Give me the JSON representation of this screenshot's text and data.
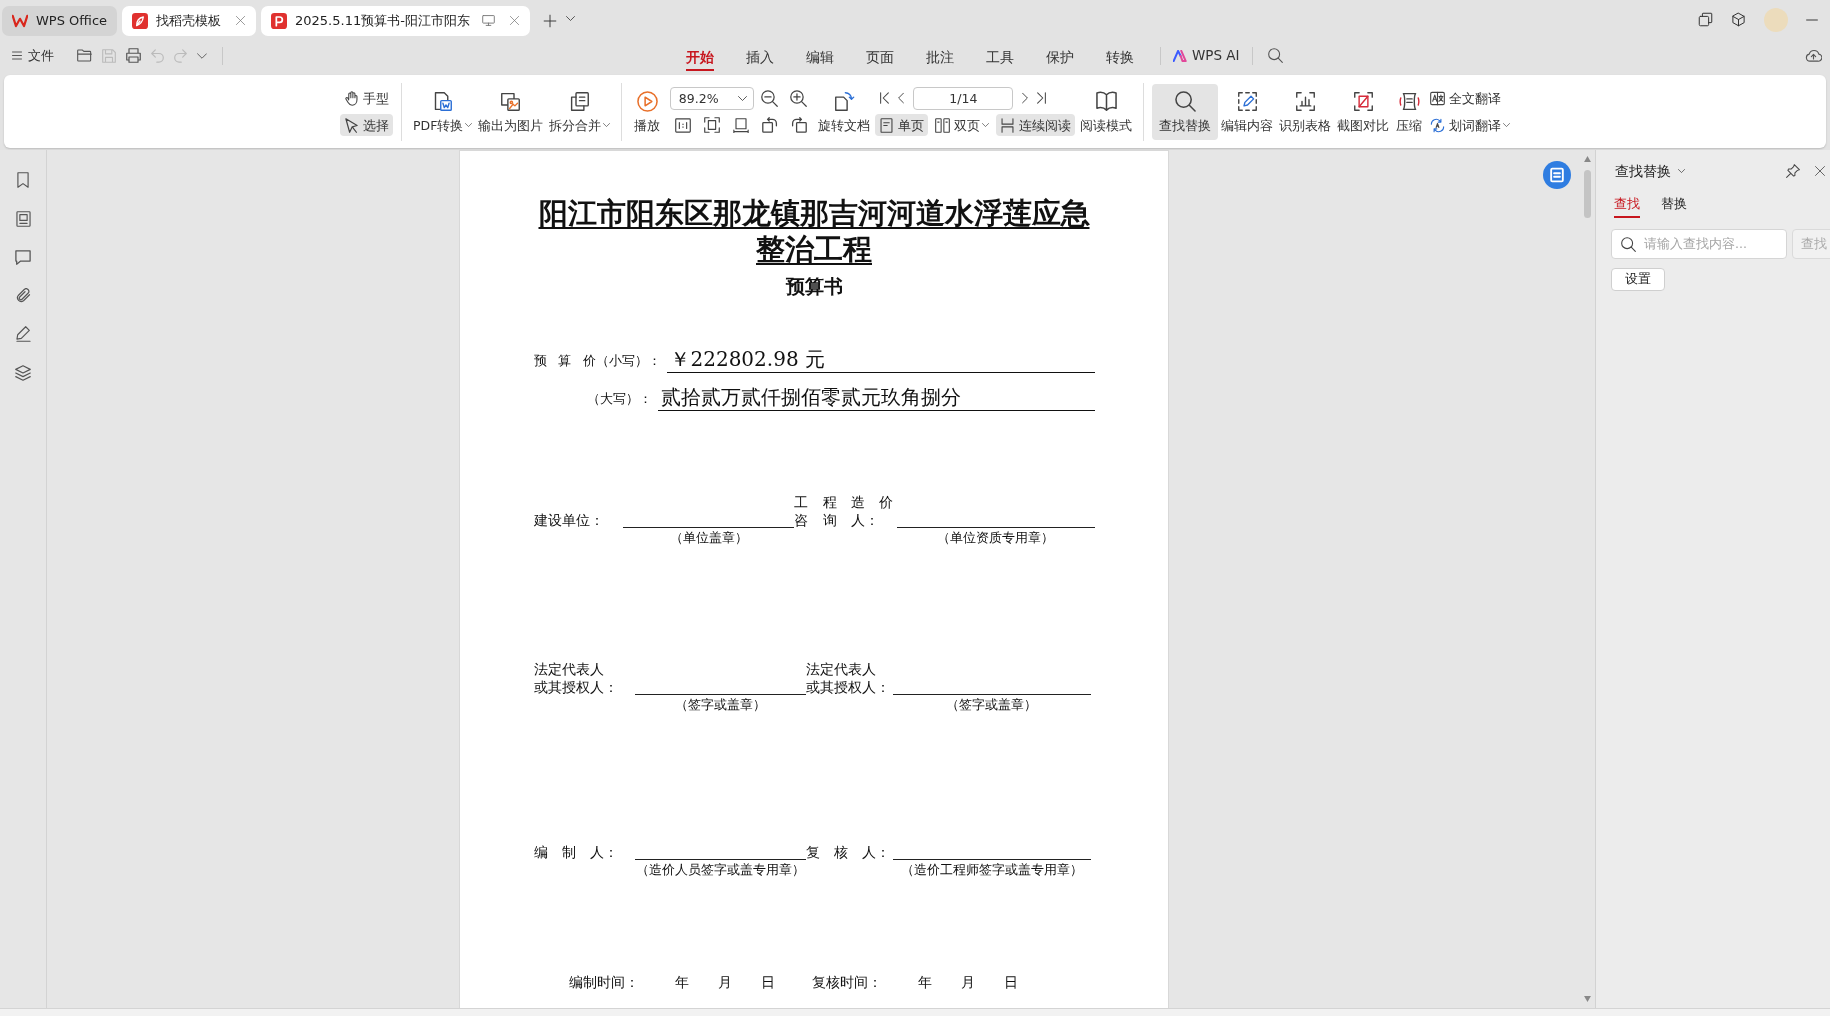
{
  "tabs": [
    {
      "label": "WPS Office",
      "kind": "home"
    },
    {
      "label": "找稻壳模板",
      "kind": "template"
    },
    {
      "label": "2025.5.11预算书-阳江市阳东",
      "kind": "pdf"
    }
  ],
  "menu_bar": {
    "file": "文件",
    "items": [
      {
        "label": "开始",
        "selected": true
      },
      {
        "label": "插入",
        "selected": false
      },
      {
        "label": "编辑",
        "selected": false
      },
      {
        "label": "页面",
        "selected": false
      },
      {
        "label": "批注",
        "selected": false
      },
      {
        "label": "工具",
        "selected": false
      },
      {
        "label": "保护",
        "selected": false
      },
      {
        "label": "转换",
        "selected": false
      }
    ],
    "ai": "WPS AI"
  },
  "toolbar": {
    "hand": {
      "label": "手型",
      "selected": false
    },
    "select": {
      "label": "选择",
      "selected": true
    },
    "pdf_convert": "PDF转换",
    "export_image": "输出为图片",
    "split_merge": "拆分合并",
    "play": "播放",
    "zoom": "89.2%",
    "rotate": "旋转文档",
    "page": "1/14",
    "single_page": {
      "label": "单页",
      "selected": true
    },
    "double_page": {
      "label": "双页",
      "selected": false
    },
    "continuous": {
      "label": "连续阅读",
      "selected": true
    },
    "reading_mode": "阅读模式",
    "find_replace": {
      "label": "查找替换",
      "selected": true
    },
    "edit_content": "编辑内容",
    "recognize_table": "识别表格",
    "screenshot_compare": "截图对比",
    "compress": "压缩",
    "translate_full": "全文翻译",
    "translate_word": "划词翻译"
  },
  "document": {
    "title": "阳江市阳东区那龙镇那吉河河道水浮莲应急整治工程",
    "subtitle": "预算书",
    "amounts": [
      {
        "label": "预 算 价（小写）：",
        "value": "￥222802.98 元"
      },
      {
        "label": "（大写）：",
        "value": "贰拾贰万贰仟捌佰零贰元玖角捌分"
      }
    ],
    "signature_rows": [
      [
        {
          "label_lines": [
            "建设单位："
          ],
          "note": "（单位盖章）"
        },
        {
          "label_lines": [
            "工 程 造 价",
            "咨 询 人："
          ],
          "note": "（单位资质专用章）"
        }
      ],
      [
        {
          "label_lines": [
            "法定代表人",
            "或其授权人："
          ],
          "note": "（签字或盖章）"
        },
        {
          "label_lines": [
            "法定代表人",
            "或其授权人："
          ],
          "note": "（签字或盖章）"
        }
      ],
      [
        {
          "label_lines": [
            "编 制 人："
          ],
          "note": "（造价人员签字或盖专用章）"
        },
        {
          "label_lines": [
            "复 核 人："
          ],
          "note": "（造价工程师签字或盖专用章）"
        }
      ]
    ],
    "dates": [
      {
        "label": "编制时间：",
        "units": [
          "年",
          "月",
          "日"
        ]
      },
      {
        "label": "复核时间：",
        "units": [
          "年",
          "月",
          "日"
        ]
      }
    ]
  },
  "find_panel": {
    "title": "查找替换",
    "tabs": [
      {
        "label": "查找",
        "selected": true
      },
      {
        "label": "替换",
        "selected": false
      }
    ],
    "search": {
      "placeholder": "请输入查找内容..."
    },
    "find_button": {
      "label": "查找",
      "disabled": true
    },
    "settings_button": "设置"
  }
}
